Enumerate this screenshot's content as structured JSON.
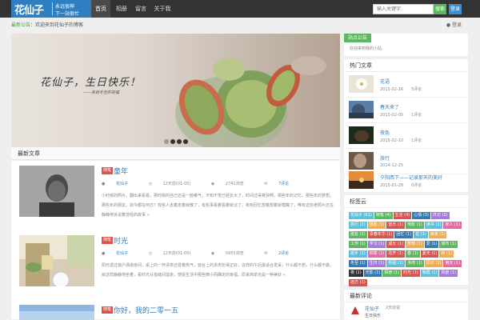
{
  "topbar": {
    "logo_main": "花仙子",
    "logo_line1": "永远很神",
    "logo_line2": "下一站很忙",
    "nav": [
      "首页",
      "相册",
      "留言",
      "关于我"
    ],
    "search_placeholder": "输入关键字",
    "search_btn": "搜索",
    "login_btn": "登录"
  },
  "notice": {
    "green": "最新公告",
    "text": "：欢迎来到花仙子的博客",
    "user": "登录"
  },
  "slider": {
    "caption": "花仙子，生日快乐！",
    "sub": "——来自冬至的祝福"
  },
  "latest": {
    "heading": "最新文章",
    "posts": [
      {
        "category": "随笔",
        "title": "童年",
        "author": "花仙子",
        "date": "12天前(01-05)",
        "views": "2741浏览",
        "comments": "7评论",
        "excerpt": "小时候的照片，翻出来看看，那时候的自己还是一脸稚气，不知不觉已经长大了，时间过得真快啊，那些年的记忆，那些年的梦想，那些年的朋友，如今都在何方？有些人走着走着就散了，有些事看着看着就淡了，有些回忆想着想着就模糊了，唯有这些老照片还在静静地诉说着曾经的故事 »"
      },
      {
        "category": "随笔",
        "title": "时光",
        "author": "花仙子",
        "date": "12天前(01-05)",
        "views": "5955浏览",
        "comments": "2评论",
        "excerpt": "阳光透过窗户洒进房间，桌上的一杯清茶还冒着热气，窗台上的多肉长得正好，这样的午后最适合发呆，什么都不想，什么都不做，就这样静静地坐着，看时光从指缝间溜走，感受生活中那些微小而确定的幸福，原来简单也是一种美好 »"
      },
      {
        "category": "随笔",
        "title": "你好，我的二零一五"
      }
    ]
  },
  "sidebar": {
    "notice_label": "站点公告",
    "notice_text": "欢迎来到我的小站",
    "popular_heading": "热门文章",
    "popular": [
      {
        "title": "花语",
        "date": "2015-02-16",
        "count": "5评论"
      },
      {
        "title": "春天来了",
        "date": "2015-02-05",
        "count": "1评论"
      },
      {
        "title": "夜色",
        "date": "2015-02-10",
        "count": "1评论"
      },
      {
        "title": "旅行",
        "date": "2014-12-25",
        "count": ""
      },
      {
        "title": "夕阳西下——记录那天的美好",
        "date": "2015-01-28",
        "count": "0评论"
      }
    ],
    "tags_heading": "标签云",
    "tags": [
      {
        "name": "花仙子 (61)",
        "color": "#5bc0de"
      },
      {
        "name": "随笔 (4)",
        "color": "#5cb85c"
      },
      {
        "name": "生活 (4)",
        "color": "#d9534f"
      },
      {
        "name": "心情 (3)",
        "color": "#337ab7"
      },
      {
        "name": "日记 (2)",
        "color": "#a47ae2"
      },
      {
        "name": "旅行 (2)",
        "color": "#5bc0de"
      },
      {
        "name": "摄影 (1)",
        "color": "#f0ad4e"
      },
      {
        "name": "音乐 (1)",
        "color": "#d9534f"
      },
      {
        "name": "电影 (1)",
        "color": "#5cb85c"
      },
      {
        "name": "读书 (1)",
        "color": "#5bc0de"
      },
      {
        "name": "家人 (1)",
        "color": "#e36ba5"
      },
      {
        "name": "朋友 (1)",
        "color": "#5cb85c"
      },
      {
        "name": "青春年华 (1)",
        "color": "#d9534f"
      },
      {
        "name": "回忆 (1)",
        "color": "#337ab7"
      },
      {
        "name": "花 (1)",
        "color": "#5bc0de"
      },
      {
        "name": "美食 (1)",
        "color": "#f0ad4e"
      },
      {
        "name": "工作 (1)",
        "color": "#5cb85c"
      },
      {
        "name": "学习 (1)",
        "color": "#a47ae2"
      },
      {
        "name": "成长 (1)",
        "color": "#d9534f"
      },
      {
        "name": "梦想 (1)",
        "color": "#f0ad4e"
      },
      {
        "name": "爱 (1)",
        "color": "#337ab7"
      },
      {
        "name": "城市 (1)",
        "color": "#5cb85c"
      },
      {
        "name": "故乡 (1)",
        "color": "#5bc0de"
      },
      {
        "name": "四季 (1)",
        "color": "#e36ba5"
      },
      {
        "name": "花开 (1)",
        "color": "#d9534f"
      },
      {
        "name": "春 (1)",
        "color": "#5cb85c"
      },
      {
        "name": "夏天 (1)",
        "color": "#d9534f"
      },
      {
        "name": "秋 (1)",
        "color": "#f0ad4e"
      },
      {
        "name": "冬至 (1)",
        "color": "#337ab7"
      },
      {
        "name": "生日 (1)",
        "color": "#a47ae2"
      },
      {
        "name": "祝福 (1)",
        "color": "#5bc0de"
      },
      {
        "name": "多肉 (1)",
        "color": "#5cb85c"
      },
      {
        "name": "阳光 (1)",
        "color": "#f0ad4e"
      },
      {
        "name": "雨天 (1)",
        "color": "#e36ba5"
      },
      {
        "name": "夜 (1)",
        "color": "#333333"
      },
      {
        "name": "光影 (1)",
        "color": "#337ab7"
      },
      {
        "name": "相册 (1)",
        "color": "#5cb85c"
      },
      {
        "name": "时光 (1)",
        "color": "#d9534f"
      },
      {
        "name": "晚霞 (1)",
        "color": "#5bc0de"
      },
      {
        "name": "风景 (1)",
        "color": "#a47ae2"
      },
      {
        "name": "远方 (1)",
        "color": "#d9534f"
      }
    ],
    "recent_heading": "最新评论",
    "recent_user": "花仙子",
    "recent_time": "2天前说",
    "recent_text": "生日快乐"
  },
  "colors": {
    "brand_blue": "#2e7fc1",
    "nav_dark": "#333333",
    "accent_green": "#5cb85c",
    "category_red": "#d9534f"
  }
}
